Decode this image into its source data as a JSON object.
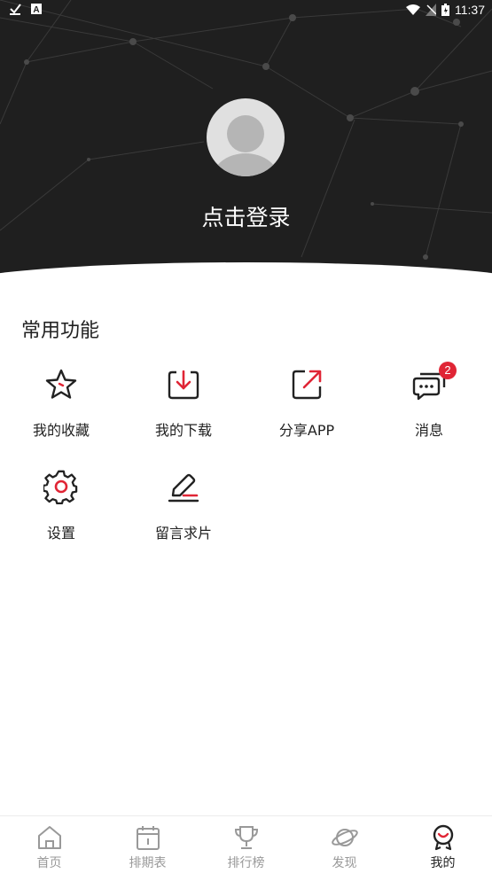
{
  "status_bar": {
    "time": "11:37"
  },
  "profile": {
    "login_label": "点击登录"
  },
  "common_functions": {
    "title": "常用功能",
    "items": [
      {
        "label": "我的收藏",
        "icon": "star-icon"
      },
      {
        "label": "我的下载",
        "icon": "download-icon"
      },
      {
        "label": "分享APP",
        "icon": "share-icon"
      },
      {
        "label": "消息",
        "icon": "message-icon",
        "badge": "2"
      },
      {
        "label": "设置",
        "icon": "gear-icon"
      },
      {
        "label": "留言求片",
        "icon": "edit-icon"
      }
    ]
  },
  "tabs": [
    {
      "label": "首页",
      "icon": "home-icon",
      "active": false
    },
    {
      "label": "排期表",
      "icon": "calendar-icon",
      "active": false
    },
    {
      "label": "排行榜",
      "icon": "trophy-icon",
      "active": false
    },
    {
      "label": "发现",
      "icon": "planet-icon",
      "active": false
    },
    {
      "label": "我的",
      "icon": "profile-icon",
      "active": true
    }
  ],
  "colors": {
    "accent": "#e02535",
    "header_bg": "#1f1f1f"
  }
}
